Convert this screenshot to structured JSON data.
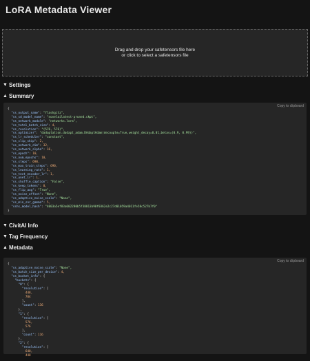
{
  "header": {
    "title": "LoRA Metadata Viewer"
  },
  "dropzone": {
    "line1": "Drag and drop your safetensors file here",
    "line2": "or click to select a safetensors file"
  },
  "sections": {
    "settings": "Settings",
    "summary": "Summary",
    "civitai": "CivitAI Info",
    "tag_frequency": "Tag Frequency",
    "metadata": "Metadata"
  },
  "copy_label": "Copy to clipboard",
  "summary": {
    "lines": [
      "{",
      "  \"ss_output_name\": \"flashgitz\",",
      "  \"ss_sd_model_name\": \"novelailatest-pruned.ckpt\",",
      "  \"ss_network_module\": \"networks.lora\",",
      "  \"ss_total_batch_size\": 4,",
      "  \"ss_resolution\": \"(576, 576)\",",
      "  \"ss_optimizer\": \"dadaptation.dadapt_adam.DAdaptAdam(decouple=True,weight_decay=0.01,betas=(0.9, 0.99))\",",
      "  \"ss_lr_scheduler\": \"constant\",",
      "  \"ss_clip_skip\": 2,",
      "  \"ss_network_dim\": 32,",
      "  \"ss_network_alpha\": 16,",
      "  \"ss_epoch\": 10,",
      "  \"ss_num_epochs\": 10,",
      "  \"ss_steps\": 690,",
      "  \"ss_max_train_steps\": 690,",
      "  \"ss_learning_rate\": 1,",
      "  \"ss_text_encoder_lr\": 1,",
      "  \"ss_unet_lr\": 1,",
      "  \"ss_shuffle_caption\": \"False\",",
      "  \"ss_keep_tokens\": 0,",
      "  \"ss_flip_aug\": \"True\",",
      "  \"ss_noise_offset\": \"None\",",
      "  \"ss_adaptive_noise_scale\": \"None\",",
      "  \"ss_min_snr_gamma\": 5,",
      "  \"sshs_model_hash\": \"4003a5ef83a602280b5f38813b90f0362e2c27d01059a4011fe58c527b7f0\"",
      "}"
    ]
  },
  "metadata": {
    "lines": [
      "{",
      "  \"ss_adaptive_noise_scale\": \"None\",",
      "  \"ss_batch_size_per_device\": 4,",
      "  \"ss_bucket_info\": {",
      "    \"buckets\": {",
      "      \"0\": {",
      "        \"resolution\": [",
      "          448,",
      "          704",
      "        ],",
      "        \"count\": 136",
      "      },",
      "      \"1\": {",
      "        \"resolution\": [",
      "          576,",
      "          576",
      "        ],",
      "        \"count\": 116",
      "      },",
      "      \"2\": {",
      "        \"resolution\": [",
      "          640,",
      "          448"
    ]
  }
}
